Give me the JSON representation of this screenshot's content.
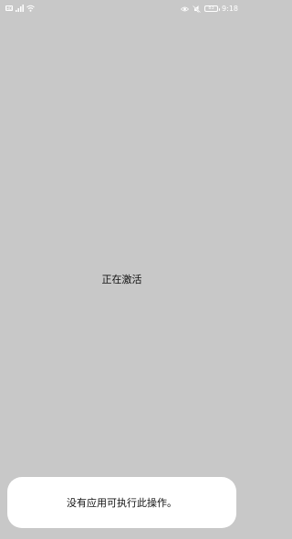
{
  "status_bar": {
    "sim_label": "HD",
    "battery_level": "83",
    "time": "9:18",
    "icons": [
      "sim-icon",
      "signal-icon",
      "wifi-icon",
      "eye-icon",
      "mute-icon",
      "battery-icon"
    ]
  },
  "main": {
    "activating_text": "正在激活"
  },
  "toast": {
    "message": "没有应用可执行此操作。"
  }
}
